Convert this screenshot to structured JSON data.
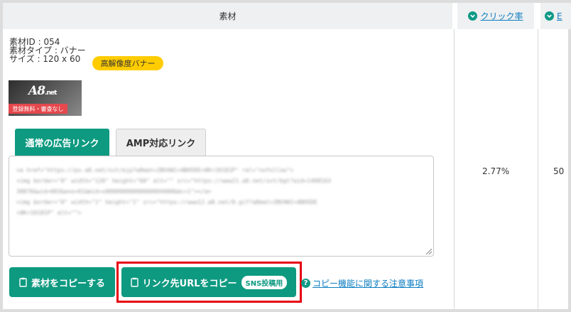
{
  "table": {
    "headers": {
      "material": "素材",
      "click_rate": "クリック率",
      "next_col_partial": "E"
    },
    "row": {
      "material_id": "素材ID : 054",
      "material_type": "素材タイプ : バナー",
      "size": "サイズ : 120 x 60",
      "size_badge": "高解像度バナー",
      "banner": {
        "logo_text": "A8",
        "logo_suffix": ".net",
        "strip_text": "登録無料・審査なし"
      },
      "tabs": [
        {
          "label": "通常の広告リンク",
          "active": true
        },
        {
          "label": "AMP対応リンク",
          "active": false
        }
      ],
      "code_lines": [
        "<a href=\"https://px.a8.net/svt/ejp?a8mat=2BU4W1+ABH5DE+0K+10181P\" rel=\"nofollow\">",
        "<img border=\"0\" width=\"120\" height=\"60\" alt=\"\" src=\"https://www21.a8.net/svt/bgt?aid=1408163",
        "38876&wid=003&eno=01&mid=s00000000000000004000&mc=1\"></a>",
        "<img border=\"0\" width=\"1\" height=\"1\" src=\"https://www12.a8.net/0.gif?a8mat=2BU4W1+ABH5DE",
        "+0K+10181P\" alt=\"\">"
      ],
      "buttons": {
        "copy_material": "素材をコピーする",
        "copy_url": "リンク先URLをコピー",
        "sns_badge": "SNS投稿用"
      },
      "help_link": "コピー機能に関する注意事項",
      "click_rate_value": "2.77%",
      "next_col_value_partial": "50"
    }
  },
  "colors": {
    "accent": "#0d9a80",
    "link": "#0d7dc1",
    "badge": "#ffcc00",
    "highlight": "#e60012"
  }
}
